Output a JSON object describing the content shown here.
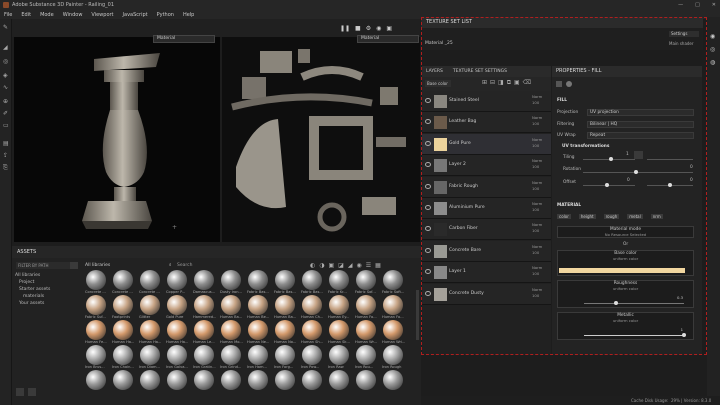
{
  "window": {
    "title": "Adobe Substance 3D Painter - Railing_01",
    "min": "—",
    "max": "□",
    "close": "✕"
  },
  "menu": [
    "File",
    "Edit",
    "Mode",
    "Window",
    "Viewport",
    "JavaScript",
    "Python",
    "Help"
  ],
  "viewport": {
    "left_mode": "Material",
    "right_mode": "Material"
  },
  "texture_set_list": {
    "title": "TEXTURE SET LIST",
    "settings": "Settings",
    "item": "Material _25",
    "shader": "Main shader"
  },
  "layers": {
    "tab1": "LAYERS",
    "tab2": "TEXTURE SET SETTINGS",
    "channel": "Base color",
    "rows": [
      {
        "name": "Stained Steel",
        "blend": "Norm",
        "op": "100",
        "thumb": "#8a8780"
      },
      {
        "name": "Leather Bag",
        "blend": "Norm",
        "op": "100",
        "thumb": "#6b5a4a"
      },
      {
        "name": "Gold Pure",
        "blend": "Norm",
        "op": "100",
        "thumb": "#ecd39c"
      },
      {
        "name": "Layer 2",
        "blend": "Norm",
        "op": "100",
        "thumb": "#777777"
      },
      {
        "name": "Fabric Rough",
        "blend": "Norm",
        "op": "100",
        "thumb": "#666666"
      },
      {
        "name": "Aluminium Pure",
        "blend": "Norm",
        "op": "100",
        "thumb": "#8c8c8c"
      },
      {
        "name": "Carbon Fiber",
        "blend": "Norm",
        "op": "100",
        "thumb": "#2a2a2a"
      },
      {
        "name": "Concrete Bare",
        "blend": "Norm",
        "op": "100",
        "thumb": "#9a9a94"
      },
      {
        "name": "Layer 1",
        "blend": "Norm",
        "op": "100",
        "thumb": "#888888"
      },
      {
        "name": "Concrete Dusty",
        "blend": "Norm",
        "op": "100",
        "thumb": "#a5a19a"
      }
    ]
  },
  "properties": {
    "title": "PROPERTIES - FILL",
    "fill": "FILL",
    "projection_label": "Projection",
    "projection": "UV projection",
    "filtering_label": "Filtering",
    "filtering": "Bilinear | HQ",
    "uvwrap_label": "UV Wrap",
    "uvwrap": "Repeat",
    "uvtrans": "UV transformations",
    "tiling_label": "Tiling",
    "tiling": "1",
    "rotation_label": "Rotation",
    "rotation": "0",
    "offset_label": "Offset",
    "offset_a": "0",
    "offset_b": "0",
    "material": "MATERIAL",
    "chips": [
      "color",
      "height",
      "rough",
      "metal",
      "nrm"
    ],
    "matmode": "Material mode",
    "nores": "No Resource Selected",
    "or": "Or",
    "basecolor": "Base color",
    "uniform": "uniform color",
    "basecolor_hex": "#f2d7a0",
    "roughness": "Roughness",
    "rough_val": "0.3",
    "metallic": "Metallic",
    "metal_val": "1"
  },
  "assets": {
    "title": "ASSETS",
    "filter": "FILTER BY PATH",
    "all": "All libraries",
    "search": "Search",
    "tree": [
      "All libraries",
      "Project",
      "Starter assets",
      "materials",
      "Your assets"
    ],
    "rows": [
      {
        "color": "#8e8e8e",
        "labels": [
          "Concrete ...",
          "Concrete ...",
          "Concrete ...",
          "Copper P...",
          "Damascus...",
          "Dusty Iron...",
          "Fabric Bas...",
          "Fabric Bas...",
          "Fabric Bas...",
          "Fabric Kr...",
          "Fabric Sof...",
          "Fabric Soft..."
        ]
      },
      {
        "color": "#c7a485",
        "labels": [
          "Fabric Suf...",
          "Footprints",
          "Glitter",
          "Gold Pure",
          "Hammered...",
          "Human Ba...",
          "Human Be...",
          "Human Ba...",
          "Human Ch...",
          "Human Ey...",
          "Human Fo...",
          "Human Fo..."
        ]
      },
      {
        "color": "#d49a6c",
        "labels": [
          "Human Fe...",
          "Human Ha...",
          "Human Ha...",
          "Human Ha...",
          "Human Le...",
          "Human Mo...",
          "Human Ne...",
          "Human No...",
          "Human Sh...",
          "Human Sk...",
          "Human Wr...",
          "Human Wri..."
        ]
      },
      {
        "color": "#a9a9a9",
        "labels": [
          "Iron Brus...",
          "Iron Chain...",
          "Iron Diam...",
          "Iron Galva...",
          "Iron Gratin...",
          "Iron Grind...",
          "Iron Ham...",
          "Iron Forg...",
          "Iron Pow...",
          "Iron Raw",
          "Iron Rou...",
          "Iron Rough"
        ]
      },
      {
        "color": "#9a9a9a",
        "labels": [
          "",
          "",
          "",
          "",
          "",
          "",
          "",
          "",
          "",
          "",
          "",
          ""
        ]
      }
    ]
  },
  "status": {
    "cache": "Cache Disk Usage:",
    "version": "29% | Version: 8.3.0"
  }
}
